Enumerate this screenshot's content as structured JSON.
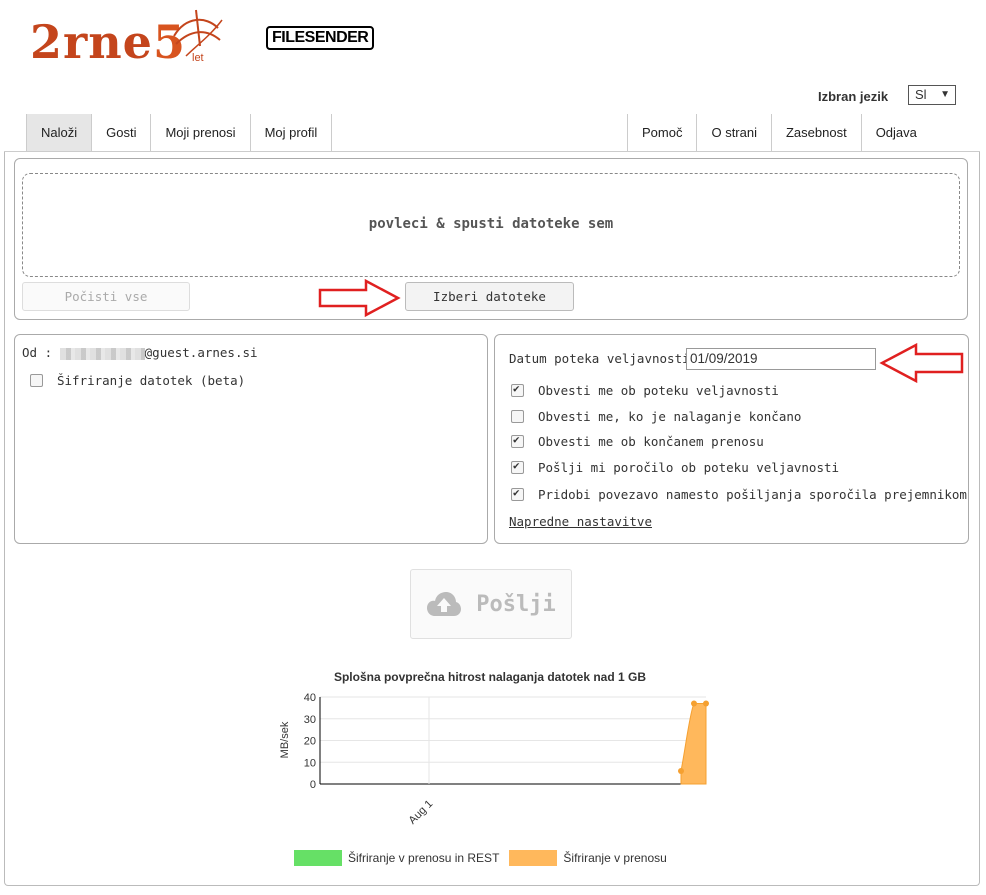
{
  "header": {
    "brand_text": "2rne",
    "brand_number": "5",
    "brand_suffix": "let",
    "product_logo": "FILESENDER",
    "language_label": "Izbran jezik",
    "language_value": "Sl",
    "language_arrow": "▼"
  },
  "nav": {
    "left_tabs": [
      {
        "label": "Naloži",
        "active": true
      },
      {
        "label": "Gosti"
      },
      {
        "label": "Moji prenosi"
      },
      {
        "label": "Moj profil"
      }
    ],
    "right_tabs": [
      {
        "label": "Pomoč"
      },
      {
        "label": "O strani"
      },
      {
        "label": "Zasebnost"
      },
      {
        "label": "Odjava"
      }
    ]
  },
  "upload": {
    "drop_text": "povleci & spusti datoteke sem",
    "clear_all": "Počisti vse",
    "select_files": "Izberi datoteke"
  },
  "sender": {
    "from_label": "Od :",
    "email_suffix": "@guest.arnes.si",
    "encrypt_label": "Šifriranje datotek (beta)",
    "encrypt_checked": false
  },
  "options": {
    "expiry_label": "Datum poteka veljavnosti:",
    "expiry_value": "01/09/2019",
    "checkboxes": [
      {
        "label": "Obvesti me ob poteku veljavnosti",
        "checked": true
      },
      {
        "label": "Obvesti me, ko je nalaganje končano",
        "checked": false
      },
      {
        "label": "Obvesti me ob končanem prenosu",
        "checked": true
      },
      {
        "label": "Pošlji mi poročilo ob poteku veljavnosti",
        "checked": true
      },
      {
        "label": "Pridobi povezavo namesto pošiljanja sporočila prejemnikom",
        "checked": true
      }
    ],
    "advanced_link": "Napredne nastavitve"
  },
  "send": {
    "label": "Pošlji"
  },
  "chart_data": {
    "type": "area",
    "title": "Splošna povprečna hitrost nalaganja datotek nad 1 GB",
    "ylabel": "MB/sek",
    "xlabel": "",
    "ylim": [
      0,
      40
    ],
    "yticks": [
      0,
      10,
      20,
      30,
      40
    ],
    "xtick_labels": [
      "Aug 1"
    ],
    "grid": true,
    "legend_position": "bottom",
    "series": [
      {
        "name": "Šifriranje v prenosu in REST",
        "color": "#66e066",
        "x": [],
        "y": []
      },
      {
        "name": "Šifriranje v prenosu",
        "color": "#ffb85c",
        "x": [
          "late Aug (1)",
          "late Aug (2)",
          "late Aug (3)"
        ],
        "y": [
          6,
          37,
          37
        ]
      }
    ]
  },
  "colors": {
    "brand": "#c4451c",
    "arrow": "#e02020",
    "series_green": "#66e066",
    "series_orange": "#ffb85c"
  }
}
